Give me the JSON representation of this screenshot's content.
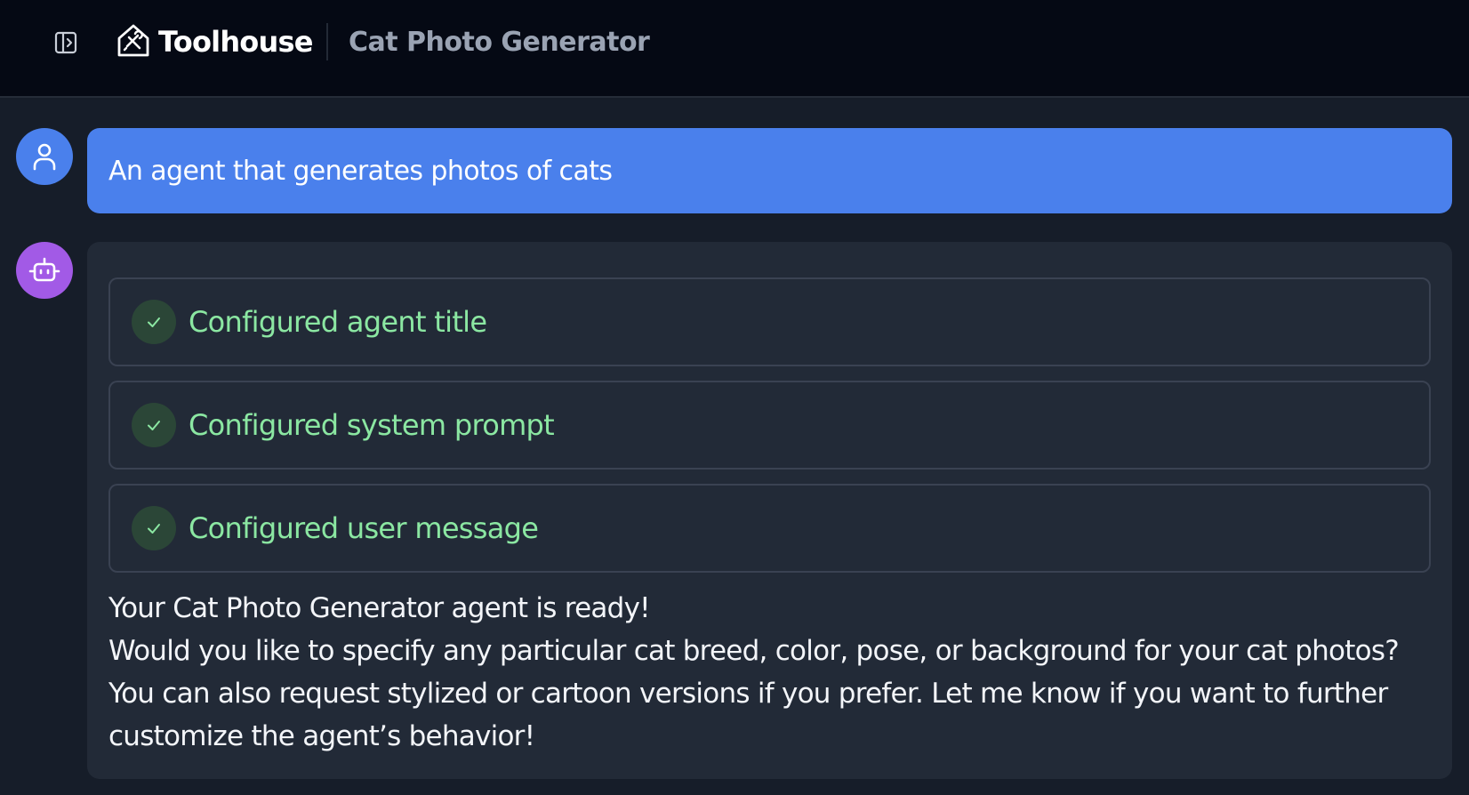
{
  "header": {
    "brand": "Toolhouse",
    "title": "Cat Photo Generator",
    "sidebar_toggle_icon": "sidebar-panel-icon",
    "logo_icon": "toolhouse-logo-icon"
  },
  "conversation": {
    "user_message": "An agent that generates photos of cats",
    "steps": [
      {
        "label": "Configured agent title",
        "status": "done"
      },
      {
        "label": "Configured system prompt",
        "status": "done"
      },
      {
        "label": "Configured user message",
        "status": "done"
      }
    ],
    "assistant_reply": {
      "line1": "Your Cat Photo Generator agent is ready!",
      "line2": "Would you like to specify any particular cat breed, color, pose, or background for your cat photos? You can also request stylized or cartoon versions if you prefer. Let me know if you want to further customize the agent’s behavior!"
    }
  },
  "colors": {
    "user_accent": "#4a80ec",
    "bot_accent": "#a25ae6",
    "success_text": "#8be7a2"
  }
}
